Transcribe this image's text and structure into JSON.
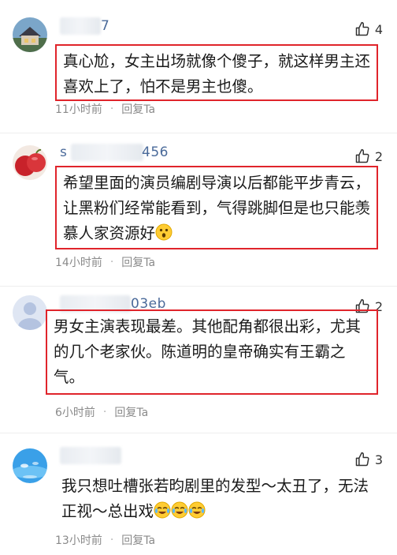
{
  "comments": [
    {
      "username_visible": "7",
      "likes": "4",
      "text": "真心尬，女主出场就像个傻子，就这样男主还喜欢上了，怕不是男主也傻。",
      "time": "11小时前",
      "separator": "·",
      "reply": "回复Ta",
      "highlighted": true,
      "avatar": "house-avatar"
    },
    {
      "username_visible": "s 456",
      "likes": "2",
      "text": "希望里面的演员编剧导演以后都能平步青云，让黑粉们经常能看到，气得跳脚但是也只能羡慕人家资源好",
      "emoji": [
        "surprised-emoji"
      ],
      "time": "14小时前",
      "separator": "·",
      "reply": "回复Ta",
      "highlighted": true,
      "avatar": "apple-avatar"
    },
    {
      "username_visible": "03eb",
      "likes": "2",
      "text": "男女主演表现最差。其他配角都很出彩，尤其的几个老家伙。陈道明的皇帝确实有王霸之气。",
      "time": "6小时前",
      "separator": "·",
      "reply": "回复Ta",
      "highlighted": true,
      "avatar": "default-avatar"
    },
    {
      "username_visible": "",
      "likes": "3",
      "text": "我只想吐槽张若昀剧里的发型～太丑了，无法正视～总出戏",
      "emoji": [
        "laughing-crying-emoji",
        "laughing-crying-emoji",
        "laughing-crying-emoji"
      ],
      "time": "13小时前",
      "separator": "·",
      "reply": "回复Ta",
      "highlighted": false,
      "avatar": "water-avatar"
    }
  ],
  "colors": {
    "highlight": "#e0242b",
    "meta": "#8a8a8a",
    "username": "#4a6a9a"
  }
}
